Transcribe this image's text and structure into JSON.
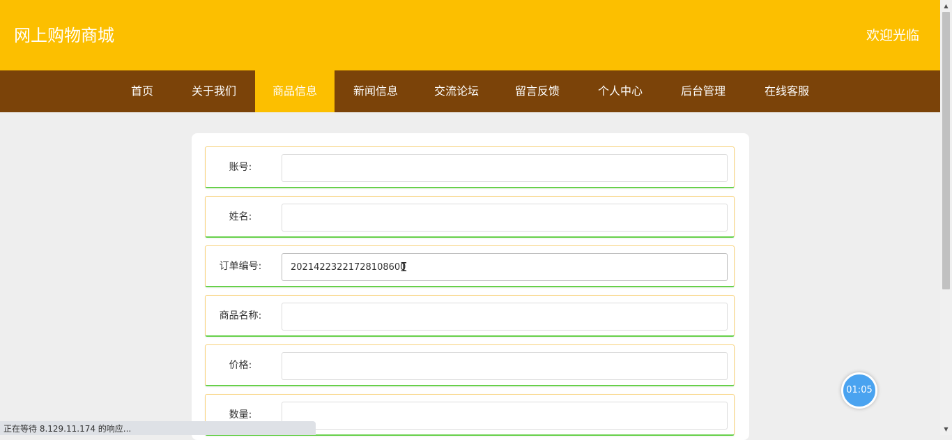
{
  "header": {
    "site_title": "网上购物商城",
    "welcome": "欢迎光临"
  },
  "nav": {
    "items": [
      {
        "label": "首页"
      },
      {
        "label": "关于我们"
      },
      {
        "label": "商品信息"
      },
      {
        "label": "新闻信息"
      },
      {
        "label": "交流论坛"
      },
      {
        "label": "留言反馈"
      },
      {
        "label": "个人中心"
      },
      {
        "label": "后台管理"
      },
      {
        "label": "在线客服"
      }
    ],
    "active": "商品信息"
  },
  "form": {
    "fields": [
      {
        "label": "账号:",
        "value": ""
      },
      {
        "label": "姓名:",
        "value": ""
      },
      {
        "label": "订单编号:",
        "value": "20214223221728108600"
      },
      {
        "label": "商品名称:",
        "value": ""
      },
      {
        "label": "价格:",
        "value": ""
      },
      {
        "label": "数量:",
        "value": ""
      }
    ]
  },
  "timer": {
    "text": "01:05"
  },
  "status_bar": {
    "text": "正在等待 8.129.11.174 的响应..."
  },
  "colors": {
    "header_bg": "#fcbf00",
    "nav_bg": "#7b4309",
    "nav_active_bg": "#fcbf00",
    "row_border_bottom": "#67d04a"
  }
}
